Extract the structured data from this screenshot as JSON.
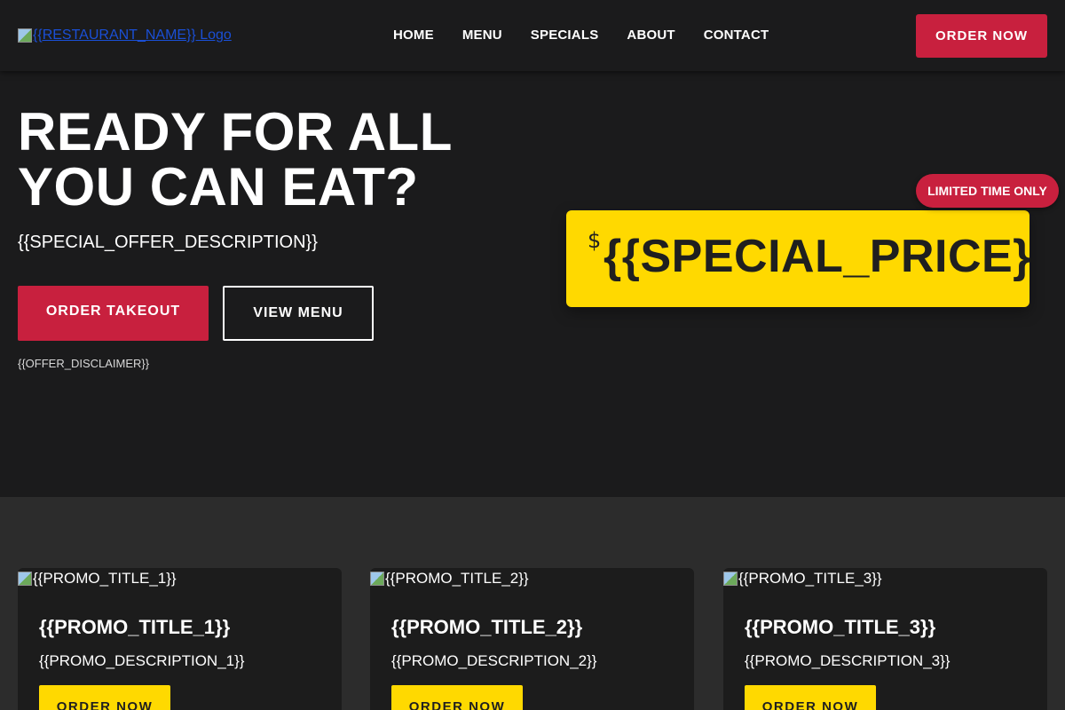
{
  "header": {
    "logo_alt": "{{RESTAURANT_NAME}} Logo",
    "nav": [
      "HOME",
      "MENU",
      "SPECIALS",
      "ABOUT",
      "CONTACT"
    ],
    "order_button": "ORDER NOW"
  },
  "hero": {
    "title": "READY FOR ALL YOU CAN EAT?",
    "description": "{{SPECIAL_OFFER_DESCRIPTION}}",
    "primary_button": "ORDER TAKEOUT",
    "secondary_button": "VIEW MENU",
    "disclaimer": "{{OFFER_DISCLAIMER}}",
    "price_currency": "$",
    "price_value": "{{SPECIAL_PRICE}}",
    "badge": "LIMITED TIME ONLY"
  },
  "promos": [
    {
      "image_alt": "{{PROMO_TITLE_1}}",
      "title": "{{PROMO_TITLE_1}}",
      "description": "{{PROMO_DESCRIPTION_1}}",
      "button": "ORDER NOW"
    },
    {
      "image_alt": "{{PROMO_TITLE_2}}",
      "title": "{{PROMO_TITLE_2}}",
      "description": "{{PROMO_DESCRIPTION_2}}",
      "button": "ORDER NOW"
    },
    {
      "image_alt": "{{PROMO_TITLE_3}}",
      "title": "{{PROMO_TITLE_3}}",
      "description": "{{PROMO_DESCRIPTION_3}}",
      "button": "ORDER NOW"
    }
  ],
  "colors": {
    "background": "#1b1b1c",
    "section_background": "#2c2c2c",
    "accent_red": "#c8203e",
    "accent_yellow": "#ffd900",
    "text": "#ffffff"
  },
  "icons": {
    "logo": "broken-image-icon",
    "promo_images": "broken-image-icon"
  }
}
